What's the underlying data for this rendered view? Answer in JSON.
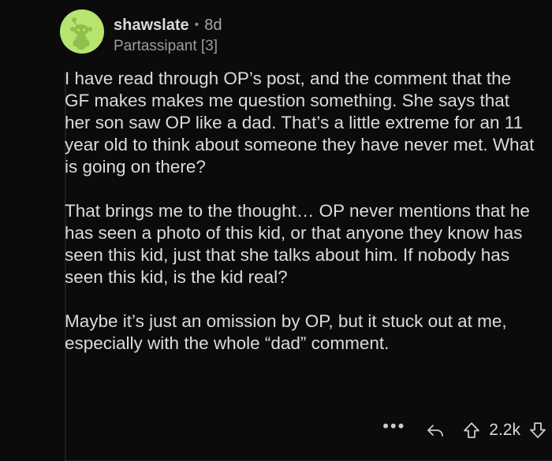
{
  "comment": {
    "username": "shawslate",
    "separator": "•",
    "age": "8d",
    "flair": "Partassipant [3]",
    "paragraphs": [
      "I have read through OP’s post, and the comment that the GF makes makes me question something. She says that her son saw OP like a dad. That’s a little extreme for an 11 year old to think about someone they have never met. What is going on there?",
      "That brings me to the thought… OP never mentions that he has seen a photo of this kid, or that anyone they know has seen this kid, just that she talks about him. If nobody has seen this kid, is the kid real?",
      "Maybe it’s just an omission by OP, but it stuck out at me, especially with the whole “dad” comment."
    ]
  },
  "actions": {
    "more": "•••",
    "score": "2.2k"
  },
  "colors": {
    "background": "#0b0b0c",
    "avatar_bg": "#b7e36f",
    "avatar_figure": "#8fbf4c"
  },
  "icons": [
    "snoo-avatar-icon",
    "reply-icon",
    "upvote-icon",
    "downvote-icon"
  ]
}
